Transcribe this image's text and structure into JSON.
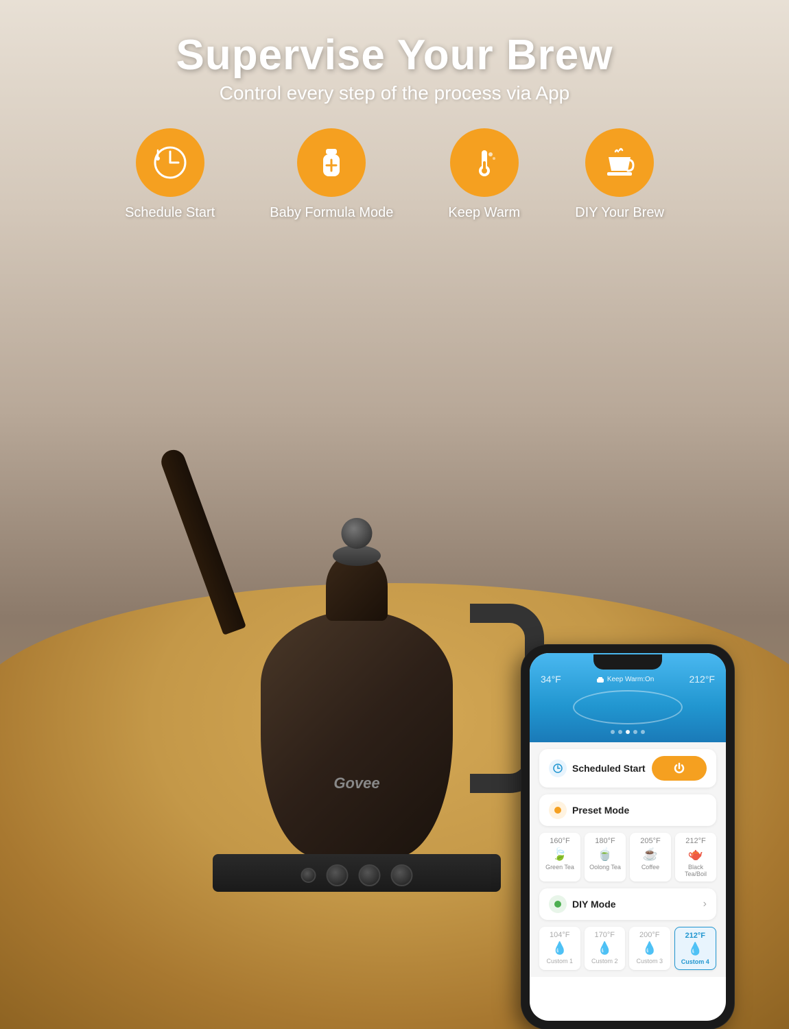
{
  "header": {
    "title": "Supervise Your Brew",
    "subtitle": "Control every step of the process via App"
  },
  "features": [
    {
      "id": "schedule-start",
      "label": "Schedule Start",
      "icon": "clock"
    },
    {
      "id": "baby-formula",
      "label": "Baby Formula Mode",
      "icon": "bottle"
    },
    {
      "id": "keep-warm",
      "label": "Keep Warm",
      "icon": "thermometer"
    },
    {
      "id": "diy-brew",
      "label": "DIY Your Brew",
      "icon": "cup"
    }
  ],
  "brand": "Govee",
  "phone": {
    "current_temp": "34°F",
    "target_temp": "212°F",
    "keep_warm": "Keep Warm:On",
    "dots": [
      false,
      false,
      true,
      false,
      false
    ],
    "scheduled_start": {
      "label": "Scheduled Start",
      "button_label": "power"
    },
    "preset_mode": {
      "label": "Preset Mode",
      "items": [
        {
          "temp": "160°F",
          "name": "Green Tea"
        },
        {
          "temp": "180°F",
          "name": "Oolong Tea"
        },
        {
          "temp": "205°F",
          "name": "Coffee"
        },
        {
          "temp": "212°F",
          "name": "Black Tea/Boil"
        }
      ]
    },
    "diy_mode": {
      "label": "DIY Mode",
      "items": [
        {
          "temp": "104°F",
          "name": "Custom 1",
          "active": false
        },
        {
          "temp": "170°F",
          "name": "Custom 2",
          "active": false
        },
        {
          "temp": "200°F",
          "name": "Custom 3",
          "active": false
        },
        {
          "temp": "212°F",
          "name": "Custom 4",
          "active": true
        }
      ]
    }
  }
}
